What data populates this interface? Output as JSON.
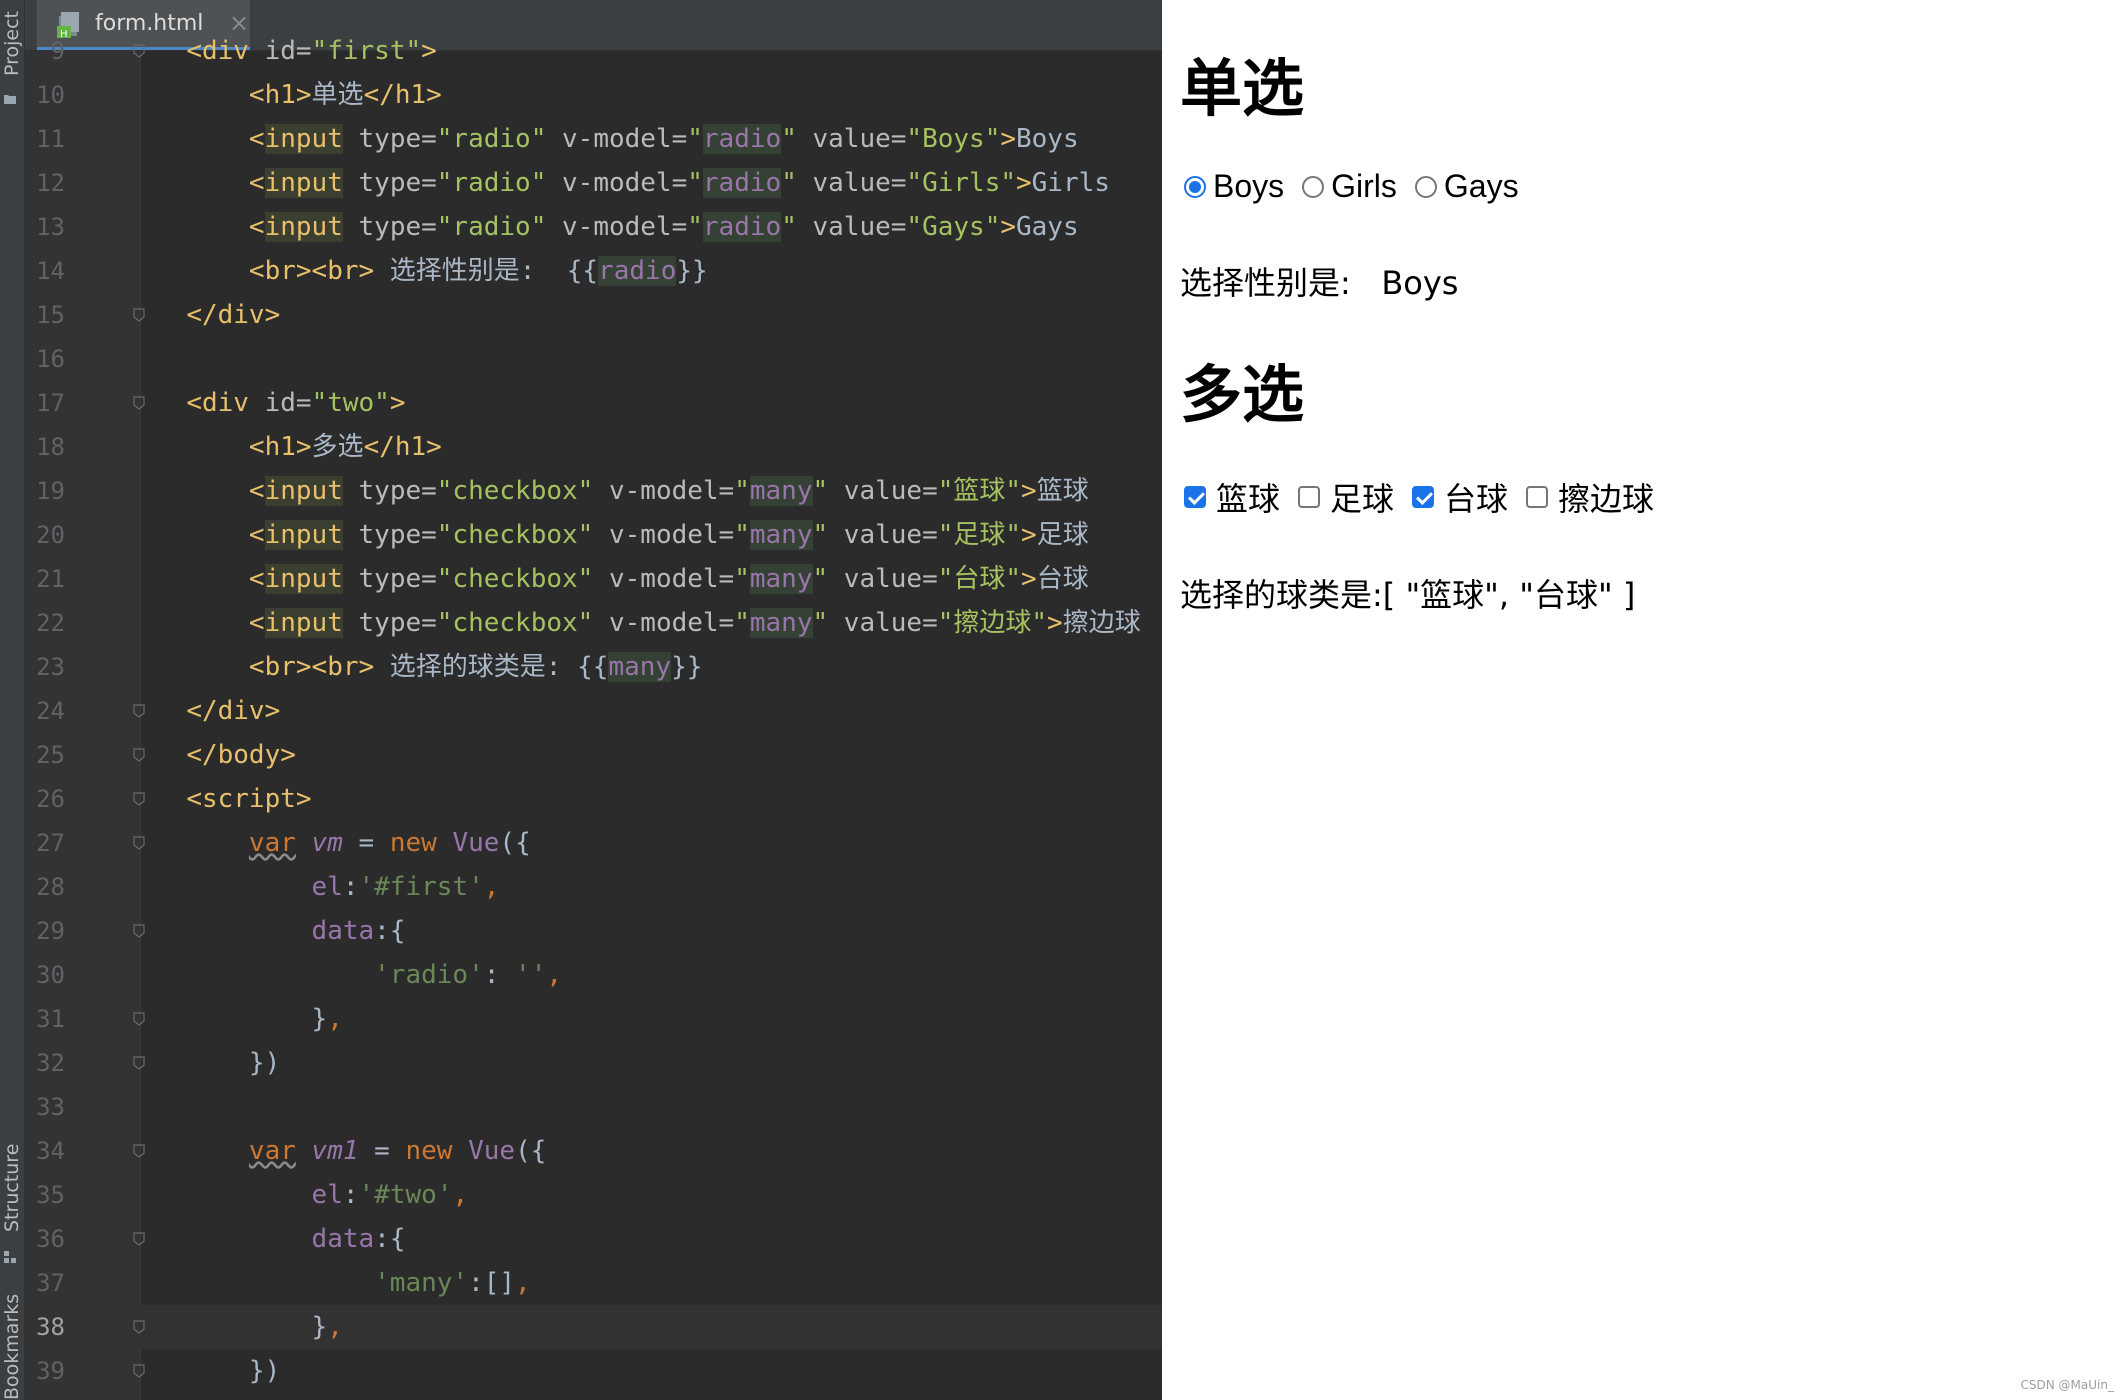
{
  "ide": {
    "tab": {
      "title": "form.html",
      "close": "×"
    },
    "strip": {
      "project": "Project",
      "structure": "Structure",
      "bookmarks": "Bookmarks"
    },
    "lines": [
      {
        "n": "9",
        "fold": true,
        "tokens": [
          [
            "  ",
            "dim"
          ],
          [
            "<div ",
            "tag"
          ],
          [
            "id=",
            "attr"
          ],
          [
            "\"first\"",
            "str"
          ],
          [
            ">",
            "tag"
          ]
        ]
      },
      {
        "n": "10",
        "fold": false,
        "tokens": [
          [
            "      ",
            "dim"
          ],
          [
            "<h1>",
            "tag"
          ],
          [
            "单选",
            "dim"
          ],
          [
            "</h1>",
            "tag"
          ]
        ]
      },
      {
        "n": "11",
        "fold": false,
        "tokens": [
          [
            "      ",
            "dim"
          ],
          [
            "<",
            "tag"
          ],
          [
            "input",
            "mark"
          ],
          [
            " type=",
            "attr"
          ],
          [
            "\"radio\"",
            "str"
          ],
          [
            " v-model=",
            "attr"
          ],
          [
            "\"",
            "str"
          ],
          [
            "radio",
            "markv"
          ],
          [
            "\"",
            "str"
          ],
          [
            " value=",
            "attr"
          ],
          [
            "\"Boys\"",
            "str"
          ],
          [
            ">",
            "tag"
          ],
          [
            "Boys",
            "dim"
          ]
        ]
      },
      {
        "n": "12",
        "fold": false,
        "tokens": [
          [
            "      ",
            "dim"
          ],
          [
            "<",
            "tag"
          ],
          [
            "input",
            "mark"
          ],
          [
            " type=",
            "attr"
          ],
          [
            "\"radio\"",
            "str"
          ],
          [
            " v-model=",
            "attr"
          ],
          [
            "\"",
            "str"
          ],
          [
            "radio",
            "markv"
          ],
          [
            "\"",
            "str"
          ],
          [
            " value=",
            "attr"
          ],
          [
            "\"Girls\"",
            "str"
          ],
          [
            ">",
            "tag"
          ],
          [
            "Girls",
            "dim"
          ]
        ]
      },
      {
        "n": "13",
        "fold": false,
        "tokens": [
          [
            "      ",
            "dim"
          ],
          [
            "<",
            "tag"
          ],
          [
            "input",
            "mark"
          ],
          [
            " type=",
            "attr"
          ],
          [
            "\"radio\"",
            "str"
          ],
          [
            " v-model=",
            "attr"
          ],
          [
            "\"",
            "str"
          ],
          [
            "radio",
            "markv"
          ],
          [
            "\"",
            "str"
          ],
          [
            " value=",
            "attr"
          ],
          [
            "\"Gays\"",
            "str"
          ],
          [
            ">",
            "tag"
          ],
          [
            "Gays",
            "dim"
          ]
        ]
      },
      {
        "n": "14",
        "fold": false,
        "tokens": [
          [
            "      ",
            "dim"
          ],
          [
            "<br><br>",
            "tag"
          ],
          [
            " 选择性别是:  {{",
            "dim"
          ],
          [
            "radio",
            "markv"
          ],
          [
            "}}",
            "dim"
          ]
        ]
      },
      {
        "n": "15",
        "fold": true,
        "tokens": [
          [
            "  ",
            "dim"
          ],
          [
            "</div>",
            "tag"
          ]
        ]
      },
      {
        "n": "16",
        "fold": false,
        "tokens": []
      },
      {
        "n": "17",
        "fold": true,
        "tokens": [
          [
            "  ",
            "dim"
          ],
          [
            "<div ",
            "tag"
          ],
          [
            "id=",
            "attr"
          ],
          [
            "\"two\"",
            "str"
          ],
          [
            ">",
            "tag"
          ]
        ]
      },
      {
        "n": "18",
        "fold": false,
        "tokens": [
          [
            "      ",
            "dim"
          ],
          [
            "<h1>",
            "tag"
          ],
          [
            "多选",
            "dim"
          ],
          [
            "</h1>",
            "tag"
          ]
        ]
      },
      {
        "n": "19",
        "fold": false,
        "tokens": [
          [
            "      ",
            "dim"
          ],
          [
            "<",
            "tag"
          ],
          [
            "input",
            "mark"
          ],
          [
            " type=",
            "attr"
          ],
          [
            "\"checkbox\"",
            "str"
          ],
          [
            " v-model=",
            "attr"
          ],
          [
            "\"",
            "str"
          ],
          [
            "many",
            "markv"
          ],
          [
            "\"",
            "str"
          ],
          [
            " value=",
            "attr"
          ],
          [
            "\"篮球\"",
            "str"
          ],
          [
            ">",
            "tag"
          ],
          [
            "篮球",
            "dim"
          ]
        ]
      },
      {
        "n": "20",
        "fold": false,
        "tokens": [
          [
            "      ",
            "dim"
          ],
          [
            "<",
            "tag"
          ],
          [
            "input",
            "mark"
          ],
          [
            " type=",
            "attr"
          ],
          [
            "\"checkbox\"",
            "str"
          ],
          [
            " v-model=",
            "attr"
          ],
          [
            "\"",
            "str"
          ],
          [
            "many",
            "markv"
          ],
          [
            "\"",
            "str"
          ],
          [
            " value=",
            "attr"
          ],
          [
            "\"足球\"",
            "str"
          ],
          [
            ">",
            "tag"
          ],
          [
            "足球",
            "dim"
          ]
        ]
      },
      {
        "n": "21",
        "fold": false,
        "tokens": [
          [
            "      ",
            "dim"
          ],
          [
            "<",
            "tag"
          ],
          [
            "input",
            "mark"
          ],
          [
            " type=",
            "attr"
          ],
          [
            "\"checkbox\"",
            "str"
          ],
          [
            " v-model=",
            "attr"
          ],
          [
            "\"",
            "str"
          ],
          [
            "many",
            "markv"
          ],
          [
            "\"",
            "str"
          ],
          [
            " value=",
            "attr"
          ],
          [
            "\"台球\"",
            "str"
          ],
          [
            ">",
            "tag"
          ],
          [
            "台球",
            "dim"
          ]
        ]
      },
      {
        "n": "22",
        "fold": false,
        "tokens": [
          [
            "      ",
            "dim"
          ],
          [
            "<",
            "tag"
          ],
          [
            "input",
            "mark"
          ],
          [
            " type=",
            "attr"
          ],
          [
            "\"checkbox\"",
            "str"
          ],
          [
            " v-model=",
            "attr"
          ],
          [
            "\"",
            "str"
          ],
          [
            "many",
            "markv"
          ],
          [
            "\"",
            "str"
          ],
          [
            " value=",
            "attr"
          ],
          [
            "\"擦边球\"",
            "str"
          ],
          [
            ">",
            "tag"
          ],
          [
            "擦边球",
            "dim"
          ]
        ]
      },
      {
        "n": "23",
        "fold": false,
        "tokens": [
          [
            "      ",
            "dim"
          ],
          [
            "<br><br>",
            "tag"
          ],
          [
            " 选择的球类是: {{",
            "dim"
          ],
          [
            "many",
            "markv"
          ],
          [
            "}}",
            "dim"
          ]
        ]
      },
      {
        "n": "24",
        "fold": true,
        "tokens": [
          [
            "  ",
            "dim"
          ],
          [
            "</div>",
            "tag"
          ]
        ]
      },
      {
        "n": "25",
        "fold": true,
        "tokens": [
          [
            "  ",
            "dim"
          ],
          [
            "</body>",
            "tag"
          ]
        ]
      },
      {
        "n": "26",
        "fold": true,
        "tokens": [
          [
            "  ",
            "dim"
          ],
          [
            "<script>",
            "tag"
          ]
        ]
      },
      {
        "n": "27",
        "fold": true,
        "tokens": [
          [
            "      ",
            "dim"
          ],
          [
            "var",
            "kw wavy"
          ],
          [
            " ",
            "dim"
          ],
          [
            "vm",
            "vname"
          ],
          [
            " = ",
            "dim"
          ],
          [
            "new ",
            "kw"
          ],
          [
            "Vue",
            "prop"
          ],
          [
            "({",
            "dim"
          ]
        ]
      },
      {
        "n": "28",
        "fold": false,
        "tokens": [
          [
            "          ",
            "dim"
          ],
          [
            "el",
            "prop"
          ],
          [
            ":",
            "dim"
          ],
          [
            "'#first'",
            "str-vue"
          ],
          [
            ",",
            "kw"
          ]
        ]
      },
      {
        "n": "29",
        "fold": true,
        "tokens": [
          [
            "          ",
            "dim"
          ],
          [
            "data",
            "prop"
          ],
          [
            ":{",
            "dim"
          ]
        ]
      },
      {
        "n": "30",
        "fold": false,
        "tokens": [
          [
            "              ",
            "dim"
          ],
          [
            "'radio'",
            "str-vue"
          ],
          [
            ": ",
            "dim"
          ],
          [
            "''",
            "str-vue"
          ],
          [
            ",",
            "kw"
          ]
        ]
      },
      {
        "n": "31",
        "fold": true,
        "tokens": [
          [
            "          ",
            "dim"
          ],
          [
            "}",
            "dim"
          ],
          [
            ",",
            "kw"
          ]
        ]
      },
      {
        "n": "32",
        "fold": true,
        "tokens": [
          [
            "      ",
            "dim"
          ],
          [
            "})",
            "dim"
          ]
        ]
      },
      {
        "n": "33",
        "fold": false,
        "tokens": []
      },
      {
        "n": "34",
        "fold": true,
        "tokens": [
          [
            "      ",
            "dim"
          ],
          [
            "var",
            "kw wavy"
          ],
          [
            " ",
            "dim"
          ],
          [
            "vm1",
            "vname"
          ],
          [
            " = ",
            "dim"
          ],
          [
            "new ",
            "kw"
          ],
          [
            "Vue",
            "prop"
          ],
          [
            "({",
            "dim"
          ]
        ]
      },
      {
        "n": "35",
        "fold": false,
        "tokens": [
          [
            "          ",
            "dim"
          ],
          [
            "el",
            "prop"
          ],
          [
            ":",
            "dim"
          ],
          [
            "'#two'",
            "str-vue"
          ],
          [
            ",",
            "kw"
          ]
        ]
      },
      {
        "n": "36",
        "fold": true,
        "tokens": [
          [
            "          ",
            "dim"
          ],
          [
            "data",
            "prop"
          ],
          [
            ":{",
            "dim"
          ]
        ]
      },
      {
        "n": "37",
        "fold": false,
        "tokens": [
          [
            "              ",
            "dim"
          ],
          [
            "'many'",
            "str-vue"
          ],
          [
            ":[]",
            "dim"
          ],
          [
            ",",
            "kw"
          ]
        ]
      },
      {
        "n": "38",
        "fold": true,
        "current": true,
        "tokens": [
          [
            "          ",
            "dim"
          ],
          [
            "}",
            "dim"
          ],
          [
            ",",
            "kw"
          ]
        ]
      },
      {
        "n": "39",
        "fold": true,
        "tokens": [
          [
            "      ",
            "dim"
          ],
          [
            "})",
            "dim"
          ]
        ]
      }
    ]
  },
  "browser": {
    "radio_section": {
      "heading": "单选",
      "options": [
        {
          "label": "Boys",
          "checked": true
        },
        {
          "label": "Girls",
          "checked": false
        },
        {
          "label": "Gays",
          "checked": false
        }
      ],
      "result_label": "选择性别是:",
      "result_value": "Boys"
    },
    "checkbox_section": {
      "heading": "多选",
      "options": [
        {
          "label": "篮球",
          "checked": true
        },
        {
          "label": "足球",
          "checked": false
        },
        {
          "label": "台球",
          "checked": true
        },
        {
          "label": "擦边球",
          "checked": false
        }
      ],
      "result_label": "选择的球类是:",
      "result_value": "[ \"篮球\", \"台球\" ]"
    },
    "watermark": "CSDN @MaUin_"
  },
  "colors": {
    "accent": "#1a73e8",
    "editor_bg": "#2b2b2b",
    "tag": "#e8bf6a",
    "string": "#a5c261"
  }
}
